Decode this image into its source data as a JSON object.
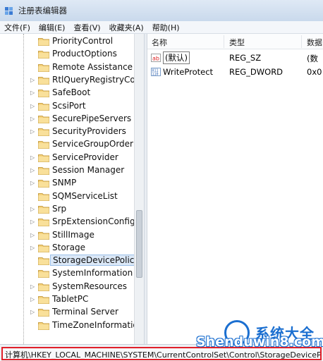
{
  "window": {
    "title": "注册表编辑器",
    "icon": "registry-editor-icon"
  },
  "menu": {
    "items": [
      "文件(F)",
      "编辑(E)",
      "查看(V)",
      "收藏夹(A)",
      "帮助(H)"
    ]
  },
  "tree": {
    "items": [
      {
        "label": "PriorityControl",
        "expandable": false,
        "selected": false
      },
      {
        "label": "ProductOptions",
        "expandable": false,
        "selected": false
      },
      {
        "label": "Remote Assistance",
        "expandable": false,
        "selected": false
      },
      {
        "label": "RtlQueryRegistryConf",
        "expandable": true,
        "selected": false
      },
      {
        "label": "SafeBoot",
        "expandable": true,
        "selected": false
      },
      {
        "label": "ScsiPort",
        "expandable": true,
        "selected": false
      },
      {
        "label": "SecurePipeServers",
        "expandable": true,
        "selected": false
      },
      {
        "label": "SecurityProviders",
        "expandable": true,
        "selected": false
      },
      {
        "label": "ServiceGroupOrder",
        "expandable": false,
        "selected": false
      },
      {
        "label": "ServiceProvider",
        "expandable": true,
        "selected": false
      },
      {
        "label": "Session Manager",
        "expandable": true,
        "selected": false
      },
      {
        "label": "SNMP",
        "expandable": true,
        "selected": false
      },
      {
        "label": "SQMServiceList",
        "expandable": false,
        "selected": false
      },
      {
        "label": "Srp",
        "expandable": true,
        "selected": false
      },
      {
        "label": "SrpExtensionConfig",
        "expandable": true,
        "selected": false
      },
      {
        "label": "StillImage",
        "expandable": true,
        "selected": false
      },
      {
        "label": "Storage",
        "expandable": true,
        "selected": false
      },
      {
        "label": "StorageDevicePolicies",
        "expandable": false,
        "selected": true
      },
      {
        "label": "SystemInformation",
        "expandable": false,
        "selected": false
      },
      {
        "label": "SystemResources",
        "expandable": true,
        "selected": false
      },
      {
        "label": "TabletPC",
        "expandable": true,
        "selected": false
      },
      {
        "label": "Terminal Server",
        "expandable": true,
        "selected": false
      },
      {
        "label": "TimeZoneInformation",
        "expandable": false,
        "selected": false
      }
    ]
  },
  "list": {
    "columns": [
      "名称",
      "类型",
      "数据"
    ],
    "rows": [
      {
        "name": "(默认)",
        "type": "REG_SZ",
        "data": "(数",
        "icon": "string-value-icon"
      },
      {
        "name": "WriteProtect",
        "type": "REG_DWORD",
        "data": "0x0",
        "icon": "binary-value-icon"
      }
    ]
  },
  "status": {
    "path": "计算机\\HKEY_LOCAL_MACHINE\\SYSTEM\\CurrentControlSet\\Control\\StorageDevicePolicies"
  },
  "watermark": {
    "cn": "系统大全",
    "en": "Shenduwin8.com"
  },
  "colors": {
    "status_highlight": "#e0202a",
    "watermark_blue": "#1b6fd0"
  }
}
